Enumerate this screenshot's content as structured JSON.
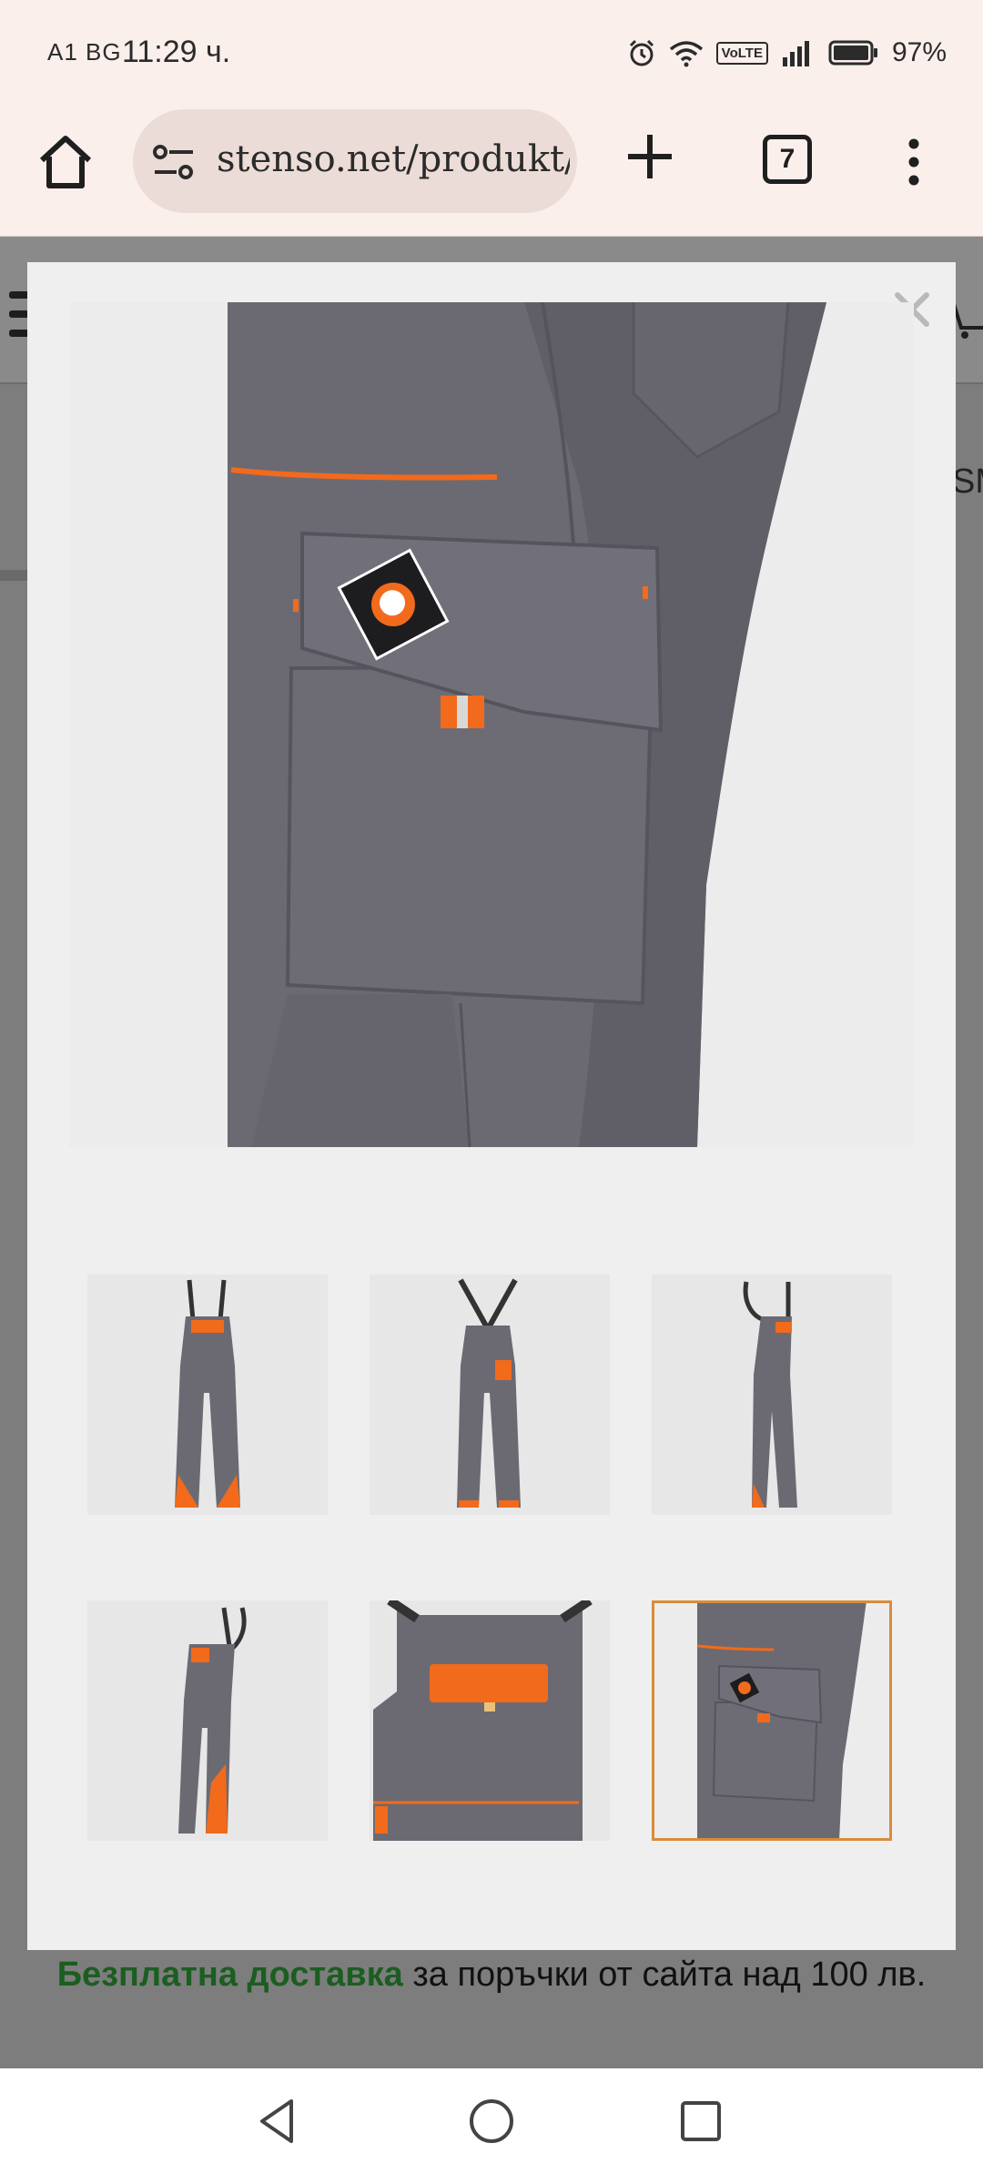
{
  "status_bar": {
    "carrier": "A1 BG",
    "time": "11:29 ч.",
    "volte": "VoLTE",
    "battery": "97%"
  },
  "browser": {
    "url": "stenso.net/produkt/",
    "tab_count": "7"
  },
  "background_page": {
    "partial_text": "SM",
    "promo_strong": "Безплатна доставка",
    "promo_rest": " за поръчки от сайта над 100 лв."
  },
  "gallery": {
    "close_label": "×",
    "selected_index": 5,
    "thumbnails": [
      {
        "view": "front"
      },
      {
        "view": "back"
      },
      {
        "view": "side"
      },
      {
        "view": "three-quarter"
      },
      {
        "view": "bib-pocket-detail"
      },
      {
        "view": "leg-pocket-detail"
      }
    ]
  },
  "colors": {
    "fabric": "#6c6a74",
    "accent": "#f26a1b",
    "selected_border": "#d98c3a",
    "promo_green": "#1b5e20"
  },
  "icons": {
    "home": "home-icon",
    "site_settings": "tune-icon",
    "new_tab": "plus-icon",
    "menu": "more-vert-icon",
    "close": "close-icon",
    "back": "back-icon",
    "home_nav": "circle-home-icon",
    "recents": "recents-icon"
  }
}
